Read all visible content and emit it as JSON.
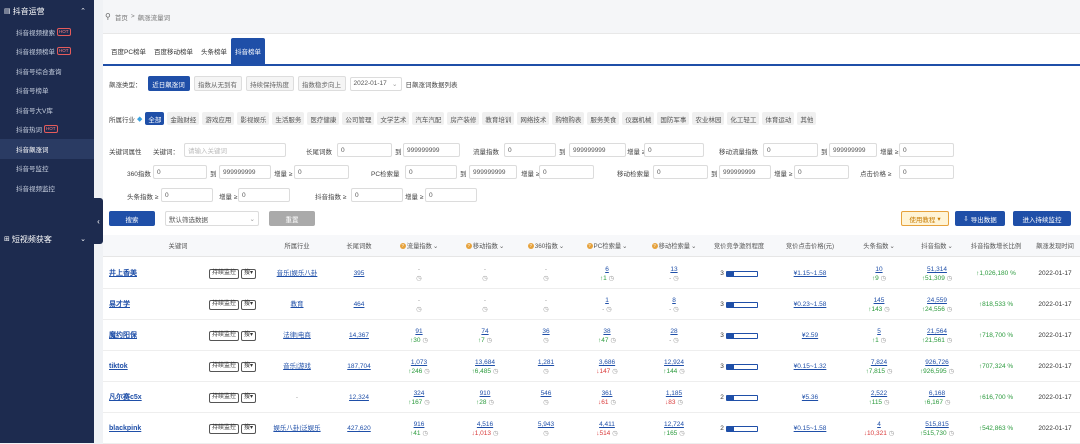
{
  "sidebar": {
    "section1": "抖音运营",
    "items": [
      {
        "label": "抖音视频搜索",
        "badge": "HOT"
      },
      {
        "label": "抖音视频榜单",
        "badge": "HOT"
      },
      {
        "label": "抖音号综合查询",
        "badge": ""
      },
      {
        "label": "抖音号榜单",
        "badge": ""
      },
      {
        "label": "抖音号大V库",
        "badge": ""
      },
      {
        "label": "抖音热词",
        "badge": "HOT"
      },
      {
        "label": "抖音飙涨词",
        "badge": ""
      },
      {
        "label": "抖音号监控",
        "badge": ""
      },
      {
        "label": "抖音视频监控",
        "badge": ""
      }
    ],
    "section2": "短视频获客"
  },
  "breadcrumb": {
    "home": "首页",
    "sep": ">",
    "current": "飙涨流量词"
  },
  "tabs": [
    "百度PC榜单",
    "百度移动榜单",
    "头条榜单",
    "抖音榜单"
  ],
  "surge": {
    "label": "飙涨类型：",
    "options": [
      "近日飙涨词",
      "指数从无到有",
      "持续保持热度",
      "指数稳步向上"
    ],
    "date": "2022-01-17",
    "suffix": "日飙涨词数据列表"
  },
  "industry": {
    "label": "所属行业",
    "items": [
      "全部",
      "金融财经",
      "游戏应用",
      "影视娱乐",
      "生活服务",
      "医疗健康",
      "公司管理",
      "文学艺术",
      "汽车汽配",
      "房产装修",
      "教育培训",
      "网络技术",
      "购物购表",
      "服务美食",
      "仪器机械",
      "国防军事",
      "农业林园",
      "化工轻工",
      "体育运动",
      "其他"
    ]
  },
  "filters": {
    "attr_label": "关键词属性",
    "kw_label": "关键词：",
    "kw_placeholder": "请输入关键词",
    "longtail": {
      "label": "长尾词数",
      "from": "0",
      "to": "999999999"
    },
    "traffic": {
      "label": "流量指数",
      "from": "0",
      "to": "999999999"
    },
    "inc": "增量 ≥",
    "inc_val": "0",
    "mobile_traffic": {
      "label": "移动流量指数",
      "from": "0",
      "to": "999999999"
    },
    "s360": {
      "label": "360指数",
      "from": "0",
      "to": "999999999"
    },
    "pc": {
      "label": "PC检索量",
      "from": "0",
      "to": "999999999"
    },
    "mobile_search": {
      "label": "移动检索量",
      "from": "0",
      "to": "999999999"
    },
    "clicks": {
      "label": "点击价格 ≥",
      "val": "0"
    },
    "to_label": "到",
    "toutiao": {
      "label": "头条指数 ≥",
      "val": "0"
    },
    "douyin": {
      "label": "抖音指数 ≥",
      "val": "0"
    }
  },
  "actions": {
    "search": "搜索",
    "sort": "默认筛选数据",
    "reset": "重置",
    "tutorial": "使用教程",
    "export": "导出数据",
    "monitor": "进入持续监控"
  },
  "table": {
    "headers": [
      "关键词",
      "所属行业",
      "长尾词数",
      "流量指数",
      "移动指数",
      "360指数",
      "PC检索量",
      "移动检索量",
      "竞价竞争激烈程度",
      "竞价点击价格(元)",
      "头条指数",
      "抖音指数",
      "抖音指数增长比例",
      "飙涨发现时间"
    ],
    "rows": [
      {
        "kw": "井上香美",
        "ind": "音乐|娱乐八卦",
        "lt": "395",
        "tr": "-",
        "trd": "",
        "mo": "-",
        "mod": "",
        "s360": "-",
        "pc": "6",
        "pcd": "↑1",
        "pcdir": "up",
        "ms": "13",
        "msd": "-",
        "msdir": "neutral",
        "comp": "3",
        "fill": 0.25,
        "price": "¥1.15~1.58",
        "tt": "10",
        "ttd": "↑9",
        "ttdir": "up",
        "dy": "51,314",
        "dyd": "↑51,309",
        "dydir": "up",
        "growth": "↑1,026,180 %",
        "date": "2022-01-17"
      },
      {
        "kw": "易才学",
        "ind": "教育",
        "lt": "464",
        "tr": "-",
        "trd": "",
        "mo": "-",
        "mod": "",
        "s360": "-",
        "pc": "1",
        "pcd": "-",
        "pcdir": "neutral",
        "ms": "8",
        "msd": "-",
        "msdir": "neutral",
        "comp": "3",
        "fill": 0.25,
        "price": "¥0.23~1.58",
        "tt": "145",
        "ttd": "↑143",
        "ttdir": "up",
        "dy": "24,559",
        "dyd": "↑24,556",
        "dydir": "up",
        "growth": "↑818,533 %",
        "date": "2022-01-17"
      },
      {
        "kw": "魔约阳保",
        "ind": "法律|电商",
        "lt": "14,367",
        "tr": "91",
        "trd": "↑30",
        "trdir": "up",
        "mo": "74",
        "mod": "↑7",
        "modir": "up",
        "s360": "36",
        "pc": "38",
        "pcd": "↑47",
        "pcdir": "up",
        "ms": "28",
        "msd": "-",
        "msdir": "neutral",
        "comp": "3",
        "fill": 0.25,
        "price": "¥2.59",
        "tt": "5",
        "ttd": "↑1",
        "ttdir": "up",
        "dy": "21,564",
        "dyd": "↑21,561",
        "dydir": "up",
        "growth": "↑718,700 %",
        "date": "2022-01-17"
      },
      {
        "kw": "tiktok",
        "ind": "音乐|游戏",
        "lt": "187,704",
        "tr": "1,073",
        "trd": "↑246",
        "trdir": "up",
        "mo": "13,684",
        "mod": "↑6,485",
        "modir": "up",
        "s360": "1,281",
        "pc": "3,686",
        "pcd": "↓147",
        "pcdir": "down",
        "ms": "12,924",
        "msd": "↑144",
        "msdir": "up",
        "comp": "3",
        "fill": 0.25,
        "price": "¥0.15~1.32",
        "tt": "7,824",
        "ttd": "↑7,815",
        "ttdir": "up",
        "dy": "926,726",
        "dyd": "↑926,595",
        "dydir": "up",
        "growth": "↑707,324 %",
        "date": "2022-01-17"
      },
      {
        "kw": "凡尔赛c5x",
        "ind": "",
        "lt": "12,324",
        "tr": "324",
        "trd": "↑167",
        "trdir": "up",
        "mo": "910",
        "mod": "↑28",
        "modir": "up",
        "s360": "546",
        "pc": "361",
        "pcd": "↓61",
        "pcdir": "down",
        "ms": "1,185",
        "msd": "↓83",
        "msdir": "down",
        "comp": "2",
        "fill": 0.25,
        "price": "¥5.36",
        "tt": "2,522",
        "ttd": "↑115",
        "ttdir": "up",
        "dy": "6,168",
        "dyd": "↑6,167",
        "dydir": "up",
        "growth": "↑616,700 %",
        "date": "2022-01-17"
      },
      {
        "kw": "blackpink",
        "ind": "娱乐八卦|泛娱乐",
        "lt": "427,620",
        "tr": "916",
        "trd": "↑41",
        "trdir": "up",
        "mo": "4,516",
        "mod": "↓1,013",
        "modir": "down",
        "s360": "5,943",
        "pc": "4,411",
        "pcd": "↓514",
        "pcdir": "down",
        "ms": "12,724",
        "msd": "↑165",
        "msdir": "up",
        "comp": "2",
        "fill": 0.25,
        "price": "¥0.15~1.58",
        "tt": "4",
        "ttd": "↓10,321",
        "ttdir": "down",
        "dy": "515,815",
        "dyd": "↑515,730",
        "dydir": "up",
        "growth": "↑542,863 %",
        "date": "2022-01-17"
      }
    ],
    "monitor_label": "持续监控",
    "more_label": "搜"
  }
}
